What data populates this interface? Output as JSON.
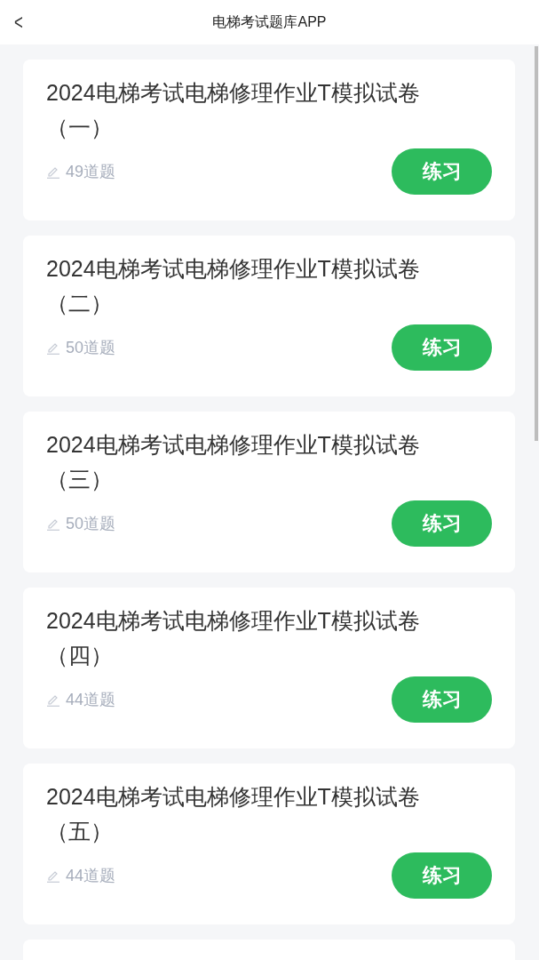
{
  "header": {
    "back": "<",
    "title": "电梯考试题库APP"
  },
  "papers": [
    {
      "title": "2024电梯考试电梯修理作业T模拟试卷（一）",
      "count": "49道题",
      "button": "练习"
    },
    {
      "title": "2024电梯考试电梯修理作业T模拟试卷（二）",
      "count": "50道题",
      "button": "练习"
    },
    {
      "title": "2024电梯考试电梯修理作业T模拟试卷（三）",
      "count": "50道题",
      "button": "练习"
    },
    {
      "title": "2024电梯考试电梯修理作业T模拟试卷（四）",
      "count": "44道题",
      "button": "练习"
    },
    {
      "title": "2024电梯考试电梯修理作业T模拟试卷（五）",
      "count": "44道题",
      "button": "练习"
    }
  ]
}
